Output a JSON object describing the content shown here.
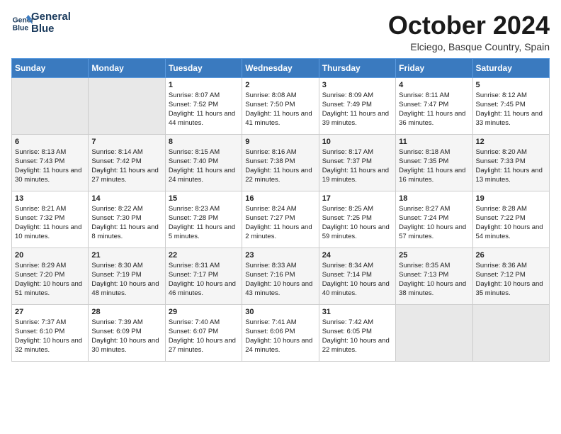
{
  "header": {
    "logo_line1": "General",
    "logo_line2": "Blue",
    "month_title": "October 2024",
    "location": "Elciego, Basque Country, Spain"
  },
  "days_of_week": [
    "Sunday",
    "Monday",
    "Tuesday",
    "Wednesday",
    "Thursday",
    "Friday",
    "Saturday"
  ],
  "weeks": [
    [
      {
        "num": "",
        "info": ""
      },
      {
        "num": "",
        "info": ""
      },
      {
        "num": "1",
        "info": "Sunrise: 8:07 AM\nSunset: 7:52 PM\nDaylight: 11 hours and 44 minutes."
      },
      {
        "num": "2",
        "info": "Sunrise: 8:08 AM\nSunset: 7:50 PM\nDaylight: 11 hours and 41 minutes."
      },
      {
        "num": "3",
        "info": "Sunrise: 8:09 AM\nSunset: 7:49 PM\nDaylight: 11 hours and 39 minutes."
      },
      {
        "num": "4",
        "info": "Sunrise: 8:11 AM\nSunset: 7:47 PM\nDaylight: 11 hours and 36 minutes."
      },
      {
        "num": "5",
        "info": "Sunrise: 8:12 AM\nSunset: 7:45 PM\nDaylight: 11 hours and 33 minutes."
      }
    ],
    [
      {
        "num": "6",
        "info": "Sunrise: 8:13 AM\nSunset: 7:43 PM\nDaylight: 11 hours and 30 minutes."
      },
      {
        "num": "7",
        "info": "Sunrise: 8:14 AM\nSunset: 7:42 PM\nDaylight: 11 hours and 27 minutes."
      },
      {
        "num": "8",
        "info": "Sunrise: 8:15 AM\nSunset: 7:40 PM\nDaylight: 11 hours and 24 minutes."
      },
      {
        "num": "9",
        "info": "Sunrise: 8:16 AM\nSunset: 7:38 PM\nDaylight: 11 hours and 22 minutes."
      },
      {
        "num": "10",
        "info": "Sunrise: 8:17 AM\nSunset: 7:37 PM\nDaylight: 11 hours and 19 minutes."
      },
      {
        "num": "11",
        "info": "Sunrise: 8:18 AM\nSunset: 7:35 PM\nDaylight: 11 hours and 16 minutes."
      },
      {
        "num": "12",
        "info": "Sunrise: 8:20 AM\nSunset: 7:33 PM\nDaylight: 11 hours and 13 minutes."
      }
    ],
    [
      {
        "num": "13",
        "info": "Sunrise: 8:21 AM\nSunset: 7:32 PM\nDaylight: 11 hours and 10 minutes."
      },
      {
        "num": "14",
        "info": "Sunrise: 8:22 AM\nSunset: 7:30 PM\nDaylight: 11 hours and 8 minutes."
      },
      {
        "num": "15",
        "info": "Sunrise: 8:23 AM\nSunset: 7:28 PM\nDaylight: 11 hours and 5 minutes."
      },
      {
        "num": "16",
        "info": "Sunrise: 8:24 AM\nSunset: 7:27 PM\nDaylight: 11 hours and 2 minutes."
      },
      {
        "num": "17",
        "info": "Sunrise: 8:25 AM\nSunset: 7:25 PM\nDaylight: 10 hours and 59 minutes."
      },
      {
        "num": "18",
        "info": "Sunrise: 8:27 AM\nSunset: 7:24 PM\nDaylight: 10 hours and 57 minutes."
      },
      {
        "num": "19",
        "info": "Sunrise: 8:28 AM\nSunset: 7:22 PM\nDaylight: 10 hours and 54 minutes."
      }
    ],
    [
      {
        "num": "20",
        "info": "Sunrise: 8:29 AM\nSunset: 7:20 PM\nDaylight: 10 hours and 51 minutes."
      },
      {
        "num": "21",
        "info": "Sunrise: 8:30 AM\nSunset: 7:19 PM\nDaylight: 10 hours and 48 minutes."
      },
      {
        "num": "22",
        "info": "Sunrise: 8:31 AM\nSunset: 7:17 PM\nDaylight: 10 hours and 46 minutes."
      },
      {
        "num": "23",
        "info": "Sunrise: 8:33 AM\nSunset: 7:16 PM\nDaylight: 10 hours and 43 minutes."
      },
      {
        "num": "24",
        "info": "Sunrise: 8:34 AM\nSunset: 7:14 PM\nDaylight: 10 hours and 40 minutes."
      },
      {
        "num": "25",
        "info": "Sunrise: 8:35 AM\nSunset: 7:13 PM\nDaylight: 10 hours and 38 minutes."
      },
      {
        "num": "26",
        "info": "Sunrise: 8:36 AM\nSunset: 7:12 PM\nDaylight: 10 hours and 35 minutes."
      }
    ],
    [
      {
        "num": "27",
        "info": "Sunrise: 7:37 AM\nSunset: 6:10 PM\nDaylight: 10 hours and 32 minutes."
      },
      {
        "num": "28",
        "info": "Sunrise: 7:39 AM\nSunset: 6:09 PM\nDaylight: 10 hours and 30 minutes."
      },
      {
        "num": "29",
        "info": "Sunrise: 7:40 AM\nSunset: 6:07 PM\nDaylight: 10 hours and 27 minutes."
      },
      {
        "num": "30",
        "info": "Sunrise: 7:41 AM\nSunset: 6:06 PM\nDaylight: 10 hours and 24 minutes."
      },
      {
        "num": "31",
        "info": "Sunrise: 7:42 AM\nSunset: 6:05 PM\nDaylight: 10 hours and 22 minutes."
      },
      {
        "num": "",
        "info": ""
      },
      {
        "num": "",
        "info": ""
      }
    ]
  ]
}
